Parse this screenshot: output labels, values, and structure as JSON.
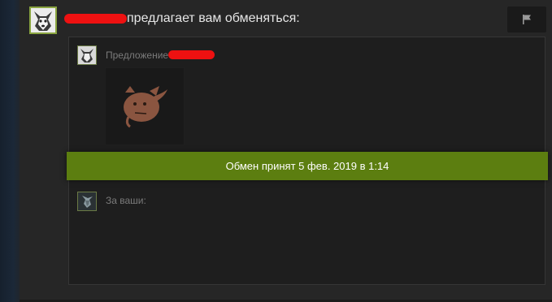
{
  "message": {
    "title": "предлагает вам обменяться:",
    "flag_icon": "flag-icon"
  },
  "offer": {
    "label_them": "Предложение",
    "label_you": "За ваши:",
    "item_icon": "pig-item-icon"
  },
  "status": {
    "text": "Обмен принят 5 фев. 2019 в 1:14",
    "color": "#5c7e10"
  },
  "colors": {
    "panel": "#262626",
    "offer_box": "#1e1e1e",
    "redaction": "#ee1111",
    "avatar_border": "#8aa540"
  }
}
